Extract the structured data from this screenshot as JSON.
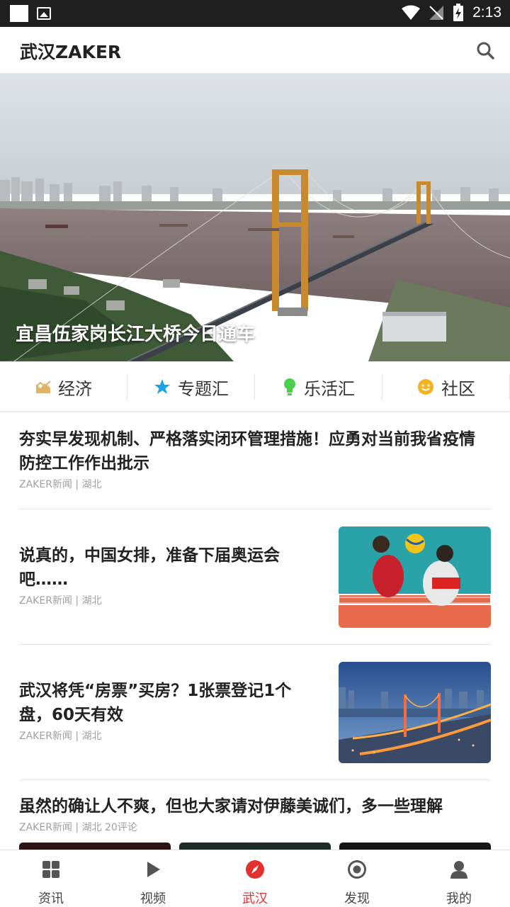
{
  "status_bar": {
    "time": "2:13"
  },
  "app_bar": {
    "title": "武汉ZAKER"
  },
  "hero": {
    "caption": "宜昌伍家岗长江大桥今日通车"
  },
  "categories": [
    {
      "label": "经济",
      "icon": "chart-icon",
      "color": "#e0b36a"
    },
    {
      "label": "专题汇",
      "icon": "star-icon",
      "color": "#1aa3e8"
    },
    {
      "label": "乐活汇",
      "icon": "bulb-icon",
      "color": "#4cd04c"
    },
    {
      "label": "社区",
      "icon": "smiley-icon",
      "color": "#f5b320"
    }
  ],
  "news": [
    {
      "title": "夯实早发现机制、严格落实闭环管理措施！应勇对当前我省疫情防控工作作出批示",
      "meta": "ZAKER新闻 | 湖北"
    },
    {
      "title": "说真的，中国女排，准备下届奥运会吧……",
      "meta": "ZAKER新闻 | 湖北",
      "thumb": "volleyball-photo"
    },
    {
      "title": "武汉将凭“房票”买房？1张票登记1个盘，60天有效",
      "meta": "ZAKER新闻 | 湖北",
      "thumb": "bridge-night-photo"
    },
    {
      "title": "虽然的确让人不爽，但也大家请对伊藤美诚们，多一些理解",
      "meta": "ZAKER新闻 | 湖北  20评论"
    }
  ],
  "bottom_nav": [
    {
      "label": "资讯",
      "icon": "grid-icon"
    },
    {
      "label": "视频",
      "icon": "play-icon"
    },
    {
      "label": "武汉",
      "icon": "compass-icon",
      "active": true
    },
    {
      "label": "发现",
      "icon": "target-icon"
    },
    {
      "label": "我的",
      "icon": "user-icon"
    }
  ],
  "colors": {
    "accent": "#e2312f",
    "status_bar": "#1f1f1f"
  }
}
